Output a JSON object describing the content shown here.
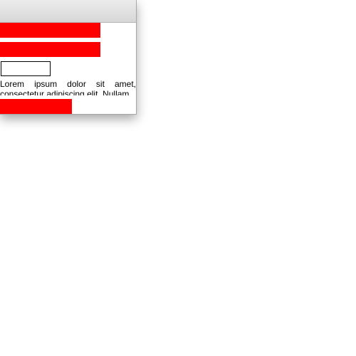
{
  "window": {
    "title": ""
  },
  "content": {
    "paragraph": "Lorem ipsum dolor sit amet, consectetur adipiscing elit. Nullam",
    "input_value": ""
  },
  "colors": {
    "bar": "#ff0000",
    "titlebar": "#dcdcdc",
    "background": "#ffffff"
  }
}
